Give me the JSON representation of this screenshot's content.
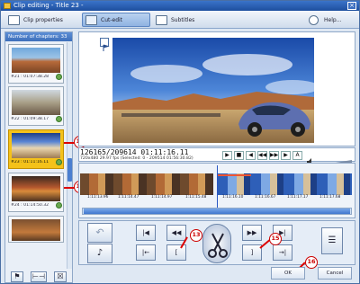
{
  "window": {
    "title": "Clip editing - Title 23 -"
  },
  "tabs": [
    {
      "label": "Clip properties"
    },
    {
      "label": "Cut-edit"
    },
    {
      "label": "Subtitles"
    },
    {
      "label": "Help..."
    }
  ],
  "active_tab": "Cut-edit",
  "chapters": {
    "header": "Number of chapters: 33",
    "items": [
      {
        "label": "#21 : 01:07:38.28"
      },
      {
        "label": "#22 : 01:09:38.17"
      },
      {
        "label": "#23 : 01:11:16.11"
      },
      {
        "label": "#24 : 01:14:50.32"
      }
    ],
    "selected_index": 2
  },
  "timecode": {
    "main": "126165/209614  01:11:16.11",
    "sub": "720x480 29.97 fps  (Selected: 0 - 209514 01:56:30.82)"
  },
  "timeline": {
    "labels": [
      "1:11:13.96",
      "1:11:14.47",
      "1:11:14.97",
      "1:11:15.48",
      "1:11:16.10",
      "1:11:16.67",
      "1:11:17.17",
      "1:11:17.68"
    ]
  },
  "callouts": [
    "12",
    "14",
    "13",
    "15",
    "16"
  ],
  "footer": {
    "ok": "OK",
    "cancel": "Cancel"
  },
  "colors": {
    "accent": "#3d6fba",
    "selected": "#f4c21a",
    "callout": "#cc0000"
  }
}
